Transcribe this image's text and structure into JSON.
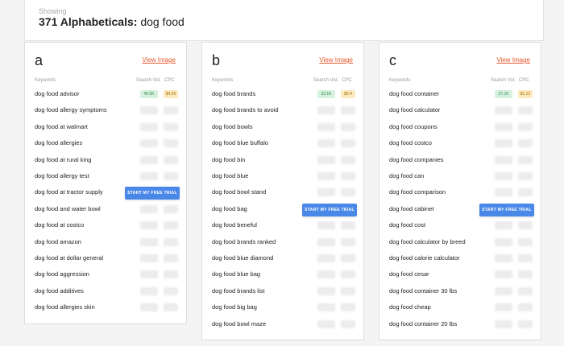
{
  "header": {
    "showing_label": "Showing",
    "count": "371 Alphabeticals:",
    "query": "dog food"
  },
  "columns": {
    "keywords": "Keywords",
    "search_vol": "Search Vol.",
    "cpc": "CPC"
  },
  "view_image_label": "View Image",
  "trial_button_label": "START MY FREE TRIAL",
  "colors": {
    "accent": "#e8572c",
    "button": "#4a88e8",
    "vol_badge": "#d6f2df",
    "cpc_badge": "#fde9bf"
  },
  "cards": [
    {
      "letter": "a",
      "first_search_vol": "40.5K",
      "first_cpc": "$4.55",
      "keywords": [
        "dog food advisor",
        "dog food allergy symptoms",
        "dog food at walmart",
        "dog food allergies",
        "dog food at rural king",
        "dog food allergy test",
        "dog food at tractor supply",
        "dog food and water bowl",
        "dog food at costco",
        "dog food amazon",
        "dog food at dollar general",
        "dog food aggression",
        "dog food additives",
        "dog food allergies skin"
      ]
    },
    {
      "letter": "b",
      "first_search_vol": "33.1K",
      "first_cpc": "$0.4",
      "keywords": [
        "dog food brands",
        "dog food brands to avoid",
        "dog food bowls",
        "dog food blue buffalo",
        "dog food bin",
        "dog food blue",
        "dog food bowl stand",
        "dog food bag",
        "dog food beneful",
        "dog food brands ranked",
        "dog food blue diamond",
        "dog food blue bag",
        "dog food brands list",
        "dog food big bag",
        "dog food bowl maze"
      ]
    },
    {
      "letter": "c",
      "first_search_vol": "27.1K",
      "first_cpc": "$1.12",
      "keywords": [
        "dog food container",
        "dog food calculator",
        "dog food coupons",
        "dog food costco",
        "dog food companies",
        "dog food can",
        "dog food comparison",
        "dog food cabinet",
        "dog food cost",
        "dog food calculator by breed",
        "dog food calorie calculator",
        "dog food cesar",
        "dog food container 30 lbs",
        "dog food cheap",
        "dog food container 20 lbs"
      ]
    }
  ]
}
